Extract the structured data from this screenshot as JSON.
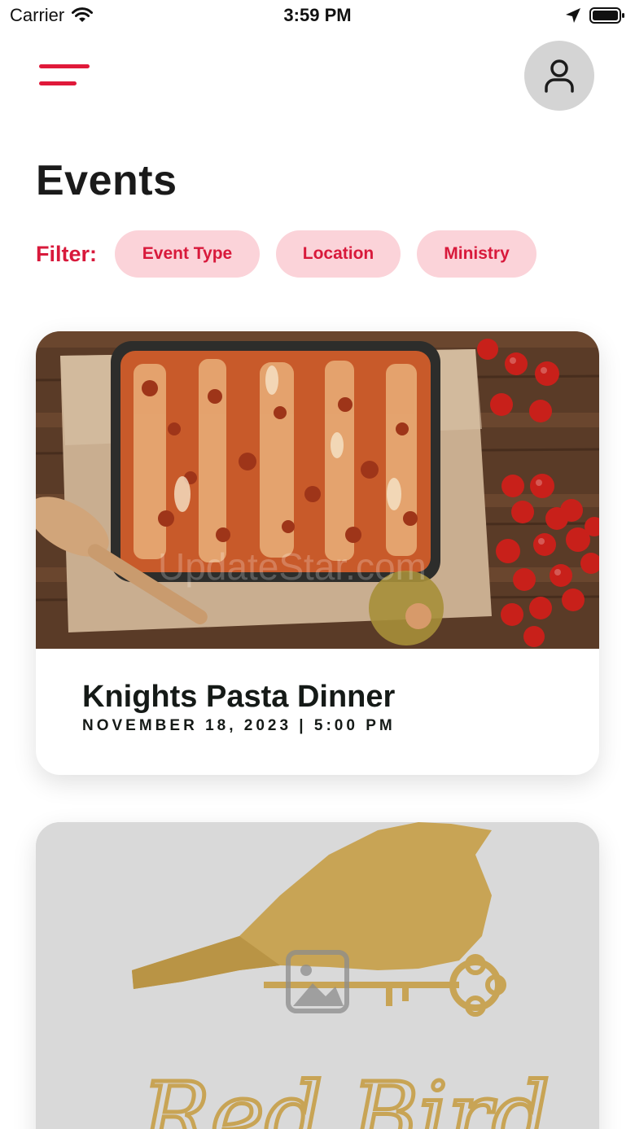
{
  "status_bar": {
    "carrier": "Carrier",
    "time": "3:59 PM"
  },
  "header": {
    "menu_icon": "hamburger-menu-icon",
    "profile_icon": "user-icon",
    "accent_color": "#e0193a"
  },
  "page": {
    "title": "Events"
  },
  "filters": {
    "label": "Filter:",
    "chips": [
      "Event Type",
      "Location",
      "Ministry"
    ],
    "chip_bg": "#fbd3d9",
    "chip_text_color": "#d8193b"
  },
  "events": [
    {
      "title": "Knights Pasta Dinner",
      "date": "NOVEMBER 18, 2023 | 5:00 PM",
      "image": "lasagna-photo",
      "watermark": "UpdateStar.com"
    },
    {
      "image": "red-bird-logo",
      "logo_lettering": "Red Bird"
    }
  ]
}
